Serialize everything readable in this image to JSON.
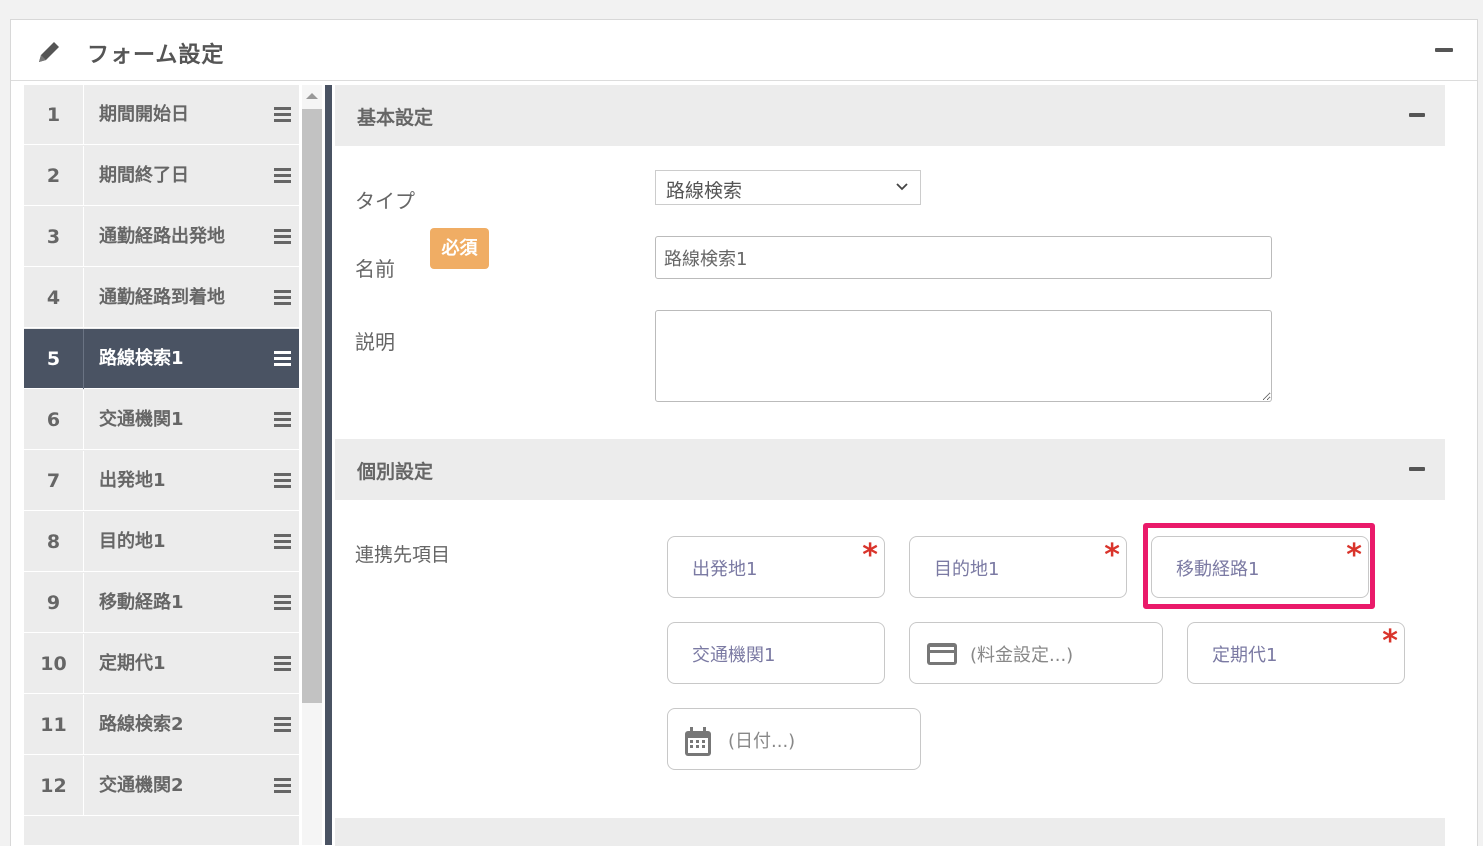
{
  "header": {
    "title": "フォーム設定"
  },
  "list": {
    "items": [
      {
        "num": "1",
        "label": "期間開始日"
      },
      {
        "num": "2",
        "label": "期間終了日"
      },
      {
        "num": "3",
        "label": "通勤経路出発地"
      },
      {
        "num": "4",
        "label": "通勤経路到着地"
      },
      {
        "num": "5",
        "label": "路線検索1",
        "active": true
      },
      {
        "num": "6",
        "label": "交通機関1"
      },
      {
        "num": "7",
        "label": "出発地1"
      },
      {
        "num": "8",
        "label": "目的地1"
      },
      {
        "num": "9",
        "label": "移動経路1"
      },
      {
        "num": "10",
        "label": "定期代1"
      },
      {
        "num": "11",
        "label": "路線検索2"
      },
      {
        "num": "12",
        "label": "交通機関2"
      }
    ]
  },
  "basic": {
    "title": "基本設定",
    "type_label": "タイプ",
    "type_value": "路線検索",
    "name_label": "名前",
    "required_badge": "必須",
    "name_value": "路線検索1",
    "desc_label": "説明",
    "desc_value": ""
  },
  "individual": {
    "title": "個別設定",
    "link_label": "連携先項目",
    "chips": [
      {
        "label": "出発地1",
        "required": "*"
      },
      {
        "label": "目的地1",
        "required": "*"
      },
      {
        "label": "移動経路1",
        "required": "*"
      },
      {
        "label": "交通機関1"
      },
      {
        "label": "(料金設定...)",
        "icon": "credit-card-icon"
      },
      {
        "label": "定期代1",
        "required": "*"
      },
      {
        "label": "(日付...)",
        "icon": "calendar-icon"
      }
    ]
  },
  "colors": {
    "accent_dark": "#4a5363",
    "badge": "#f0ad64",
    "highlight": "#ea1a6a",
    "asterisk": "#d9342b"
  }
}
